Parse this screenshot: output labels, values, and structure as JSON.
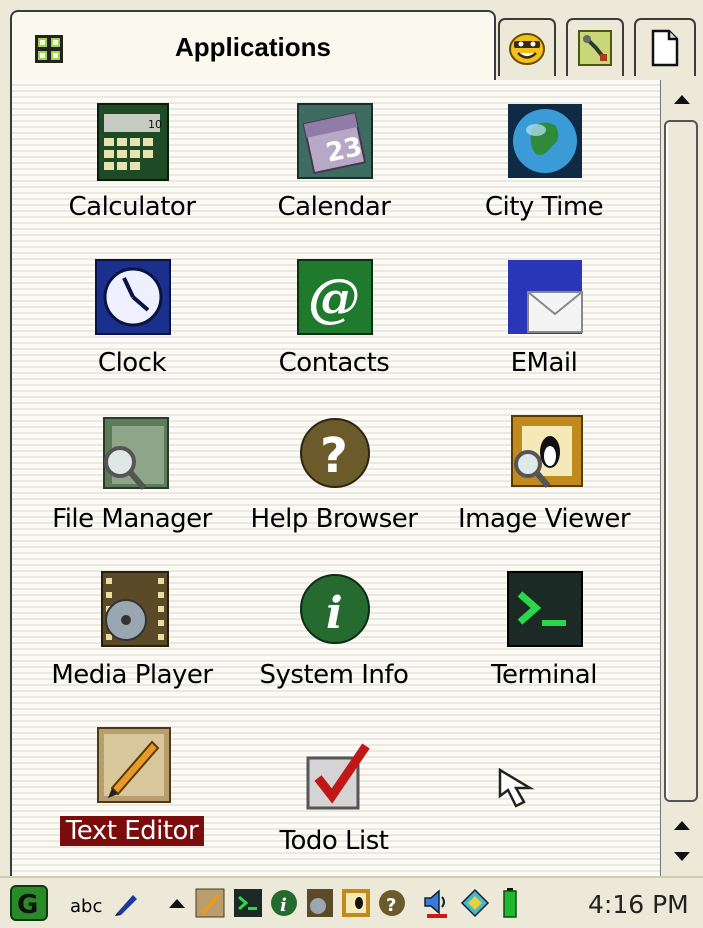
{
  "tabs": {
    "active_label": "Applications",
    "others": [
      "games-icon",
      "settings-icon",
      "documents-icon"
    ]
  },
  "apps": [
    {
      "label": "Calculator",
      "icon": "calculator-icon"
    },
    {
      "label": "Calendar",
      "icon": "calendar-icon"
    },
    {
      "label": "City Time",
      "icon": "globe-icon"
    },
    {
      "label": "Clock",
      "icon": "clock-icon"
    },
    {
      "label": "Contacts",
      "icon": "at-sign-icon"
    },
    {
      "label": "EMail",
      "icon": "envelope-icon"
    },
    {
      "label": "File Manager",
      "icon": "file-manager-icon"
    },
    {
      "label": "Help Browser",
      "icon": "help-icon"
    },
    {
      "label": "Image Viewer",
      "icon": "image-viewer-icon"
    },
    {
      "label": "Media Player",
      "icon": "film-reel-icon"
    },
    {
      "label": "System Info",
      "icon": "info-icon"
    },
    {
      "label": "Terminal",
      "icon": "terminal-icon"
    },
    {
      "label": "Text Editor",
      "icon": "pencil-icon",
      "selected": true
    },
    {
      "label": "Todo List",
      "icon": "checkmark-icon"
    }
  ],
  "calendar_icon_day": "23",
  "calculator_display": "10",
  "taskbar": {
    "input_method_label": "abc",
    "clock": "4:16 PM"
  },
  "colors": {
    "selection_bg": "#7a0c0c",
    "chrome_bg": "#ece9d8"
  }
}
